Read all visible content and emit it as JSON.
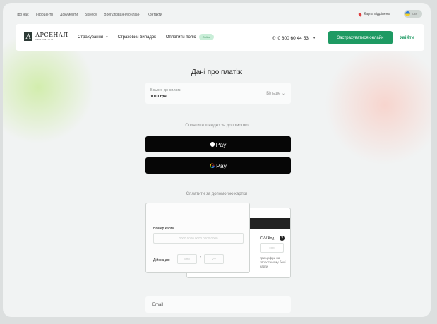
{
  "topbar": {
    "links": [
      "Про нас",
      "Інфоцентр",
      "Документи",
      "Бізнесу",
      "Врегулювання онлайн",
      "Контакти"
    ],
    "map_label": "Карта відділень",
    "lang": "Ukr"
  },
  "navbar": {
    "logo_mark": "А",
    "logo_text": "АРСЕНАЛ",
    "logo_sub": "СТРАХУВАННЯ",
    "items": {
      "insurance": "Страхування",
      "case": "Страховий випадок",
      "pay": "Оплатити поліс"
    },
    "pay_badge": "Online",
    "phone": "0 800 60 44 53",
    "cta": "Застрахуватися онлайн",
    "login": "Увійти"
  },
  "payment": {
    "title": "Дані про платіж",
    "total_label": "Всього до сплати",
    "total_amount": "1010 грн",
    "more": "Більше",
    "quick_label": "Сплатити швидко за допомогою",
    "apple_pay": "Pay",
    "google_g": "G",
    "google_pay": "Pay",
    "card_label": "Сплатити за допомогою картки"
  },
  "card": {
    "number_label": "Номер карти",
    "number_placeholder": "0000 0000 0000 0000 0000",
    "expiry_label": "Дійсна до:",
    "mm_placeholder": "MM",
    "yy_placeholder": "YY",
    "cvv_label": "CVV Код",
    "cvv_help": "?",
    "cvv_placeholder": "000",
    "cvv_hint": "три цифри на зворотньому боці карти"
  },
  "email": {
    "label": "Email"
  },
  "colors": {
    "accent": "#1e9a63",
    "dark": "#060606",
    "bg": "#f1f3f3"
  }
}
